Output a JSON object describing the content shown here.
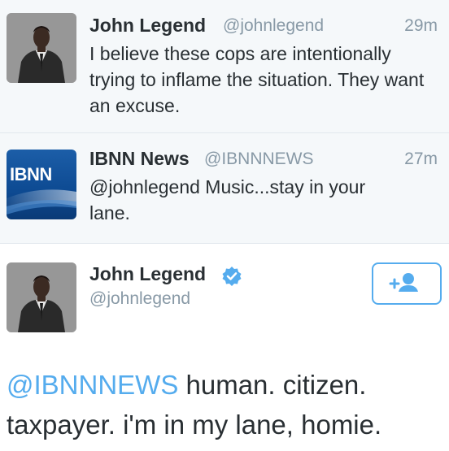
{
  "tweets": [
    {
      "name": "John Legend",
      "handle": "@johnlegend",
      "time": "29m",
      "text": "I believe these cops are intentionally trying to inflame the situation.  They want an excuse."
    },
    {
      "name": "IBNN News",
      "handle": "@IBNNNEWS",
      "time": "27m",
      "text": "@johnlegend Music...stay in your lane.",
      "avatar_label": "IBNN"
    }
  ],
  "profile_tweet": {
    "name": "John Legend",
    "handle": "@johnlegend",
    "mention": "@IBNNNEWS",
    "text": " human.  citizen. taxpayer.  i'm in my lane, homie."
  },
  "colors": {
    "accent": "#55acee",
    "muted": "#8899a6",
    "text": "#292f33",
    "tweet_bg": "#f5f8fa"
  },
  "icons": [
    "verified-badge-icon",
    "follow-add-user-icon"
  ]
}
